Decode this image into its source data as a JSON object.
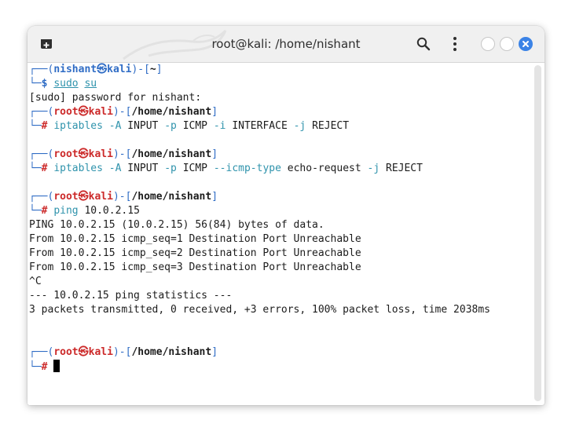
{
  "window": {
    "title": "root@kali: /home/nishant",
    "accent": "#3b83e6"
  },
  "icons": {
    "new_tab": "new-tab-icon",
    "search": "search-icon",
    "menu": "kebab-menu-icon",
    "minimize": "minimize-icon",
    "maximize": "maximize-icon",
    "close": "close-icon"
  },
  "prompts": {
    "open": "┌──(",
    "mid": ")-[",
    "close": "]",
    "second": "└─",
    "user_name": "nishant",
    "root_name": "root",
    "host_sep": "㉿",
    "host": "kali",
    "user_path": "~",
    "root_path": "/home/nishant",
    "user_symbol": "$",
    "root_symbol": "#"
  },
  "commands": {
    "sudo": {
      "program": "sudo",
      "args": "su"
    },
    "sudo_password": "[sudo] password for nishant:",
    "iptables1": {
      "program": "iptables",
      "f1": "-A",
      "a1": "INPUT",
      "f2": "-p",
      "a2": "ICMP",
      "f3": "-i",
      "a3": "INTERFACE",
      "f4": "-j",
      "a4": "REJECT"
    },
    "iptables2": {
      "program": "iptables",
      "f1": "-A",
      "a1": "INPUT",
      "f2": "-p",
      "a2": "ICMP",
      "f3": "--icmp-type",
      "a3": "echo-request",
      "f4": "-j",
      "a4": "REJECT"
    },
    "ping": {
      "program": "ping",
      "args": "10.0.2.15"
    }
  },
  "output": {
    "ping_lines": [
      "PING 10.0.2.15 (10.0.2.15) 56(84) bytes of data.",
      "From 10.0.2.15 icmp_seq=1 Destination Port Unreachable",
      "From 10.0.2.15 icmp_seq=2 Destination Port Unreachable",
      "From 10.0.2.15 icmp_seq=3 Destination Port Unreachable",
      "^C",
      "--- 10.0.2.15 ping statistics ---",
      "3 packets transmitted, 0 received, +3 errors, 100% packet loss, time 2038ms"
    ]
  }
}
